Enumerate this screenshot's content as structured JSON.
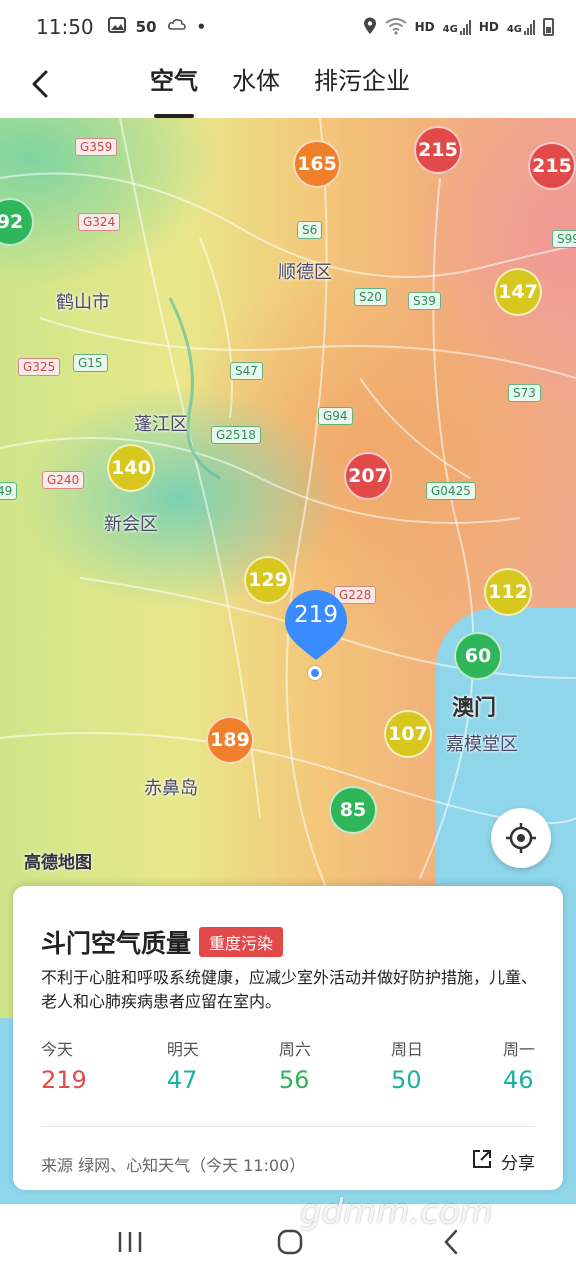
{
  "status_bar": {
    "time": "11:50",
    "icons": [
      "image-icon",
      "notification-50-icon",
      "weather-cloud-icon",
      "dot-icon"
    ],
    "notification_count": "50",
    "right_icons": [
      "location-icon",
      "wifi-icon",
      "hd-icon",
      "4g-signal-icon",
      "hd-icon",
      "4g-signal-icon",
      "battery-icon"
    ],
    "hd_label": "HD",
    "net_label": "4G"
  },
  "nav": {
    "back_icon": "chevron-left-icon",
    "tabs": [
      {
        "label": "空气",
        "active": true
      },
      {
        "label": "水体",
        "active": false
      },
      {
        "label": "排污企业",
        "active": false
      }
    ]
  },
  "map": {
    "places": [
      {
        "name": "鹤山市"
      },
      {
        "name": "顺德区"
      },
      {
        "name": "蓬江区"
      },
      {
        "name": "新会区"
      },
      {
        "name": "澳门"
      },
      {
        "name": "嘉模堂区"
      },
      {
        "name": "赤鼻岛"
      }
    ],
    "roads": [
      "G359",
      "G324",
      "S6",
      "S20",
      "S39",
      "S99",
      "G325",
      "G15",
      "S47",
      "G94",
      "S73",
      "G2518",
      "G240",
      "G0425",
      "G228",
      "49"
    ],
    "stations": [
      {
        "value": "165",
        "level": "orange"
      },
      {
        "value": "215",
        "level": "red"
      },
      {
        "value": "215",
        "level": "red"
      },
      {
        "value": "92",
        "level": "green"
      },
      {
        "value": "147",
        "level": "yellow"
      },
      {
        "value": "140",
        "level": "yellow"
      },
      {
        "value": "207",
        "level": "red"
      },
      {
        "value": "129",
        "level": "yellow"
      },
      {
        "value": "112",
        "level": "yellow"
      },
      {
        "value": "60",
        "level": "green"
      },
      {
        "value": "189",
        "level": "orange"
      },
      {
        "value": "107",
        "level": "yellow"
      },
      {
        "value": "85",
        "level": "green"
      }
    ],
    "current_value": "219",
    "current_icon": "location-pin-icon",
    "locate_icon": "locate-crosshair-icon",
    "map_logo": "高德地图"
  },
  "card": {
    "title": "斗门空气质量",
    "badge": "重度污染",
    "badge_color": "#e24a4a",
    "description": "不利于心脏和呼吸系统健康，应减少室外活动并做好防护措施，儿童、老人和心肺疾病患者应留在室内。",
    "forecast": [
      {
        "day": "今天",
        "value": "219",
        "color": "red"
      },
      {
        "day": "明天",
        "value": "47",
        "color": "teal"
      },
      {
        "day": "周六",
        "value": "56",
        "color": "green"
      },
      {
        "day": "周日",
        "value": "50",
        "color": "teal"
      },
      {
        "day": "周一",
        "value": "46",
        "color": "teal"
      }
    ],
    "source": "来源 绿网、心知天气（今天 11:00）",
    "share_label": "分享",
    "share_icon": "share-icon"
  },
  "system_nav": {
    "buttons": [
      "recent-apps-icon",
      "home-icon",
      "back-icon"
    ]
  },
  "watermark": "gdmm.com"
}
